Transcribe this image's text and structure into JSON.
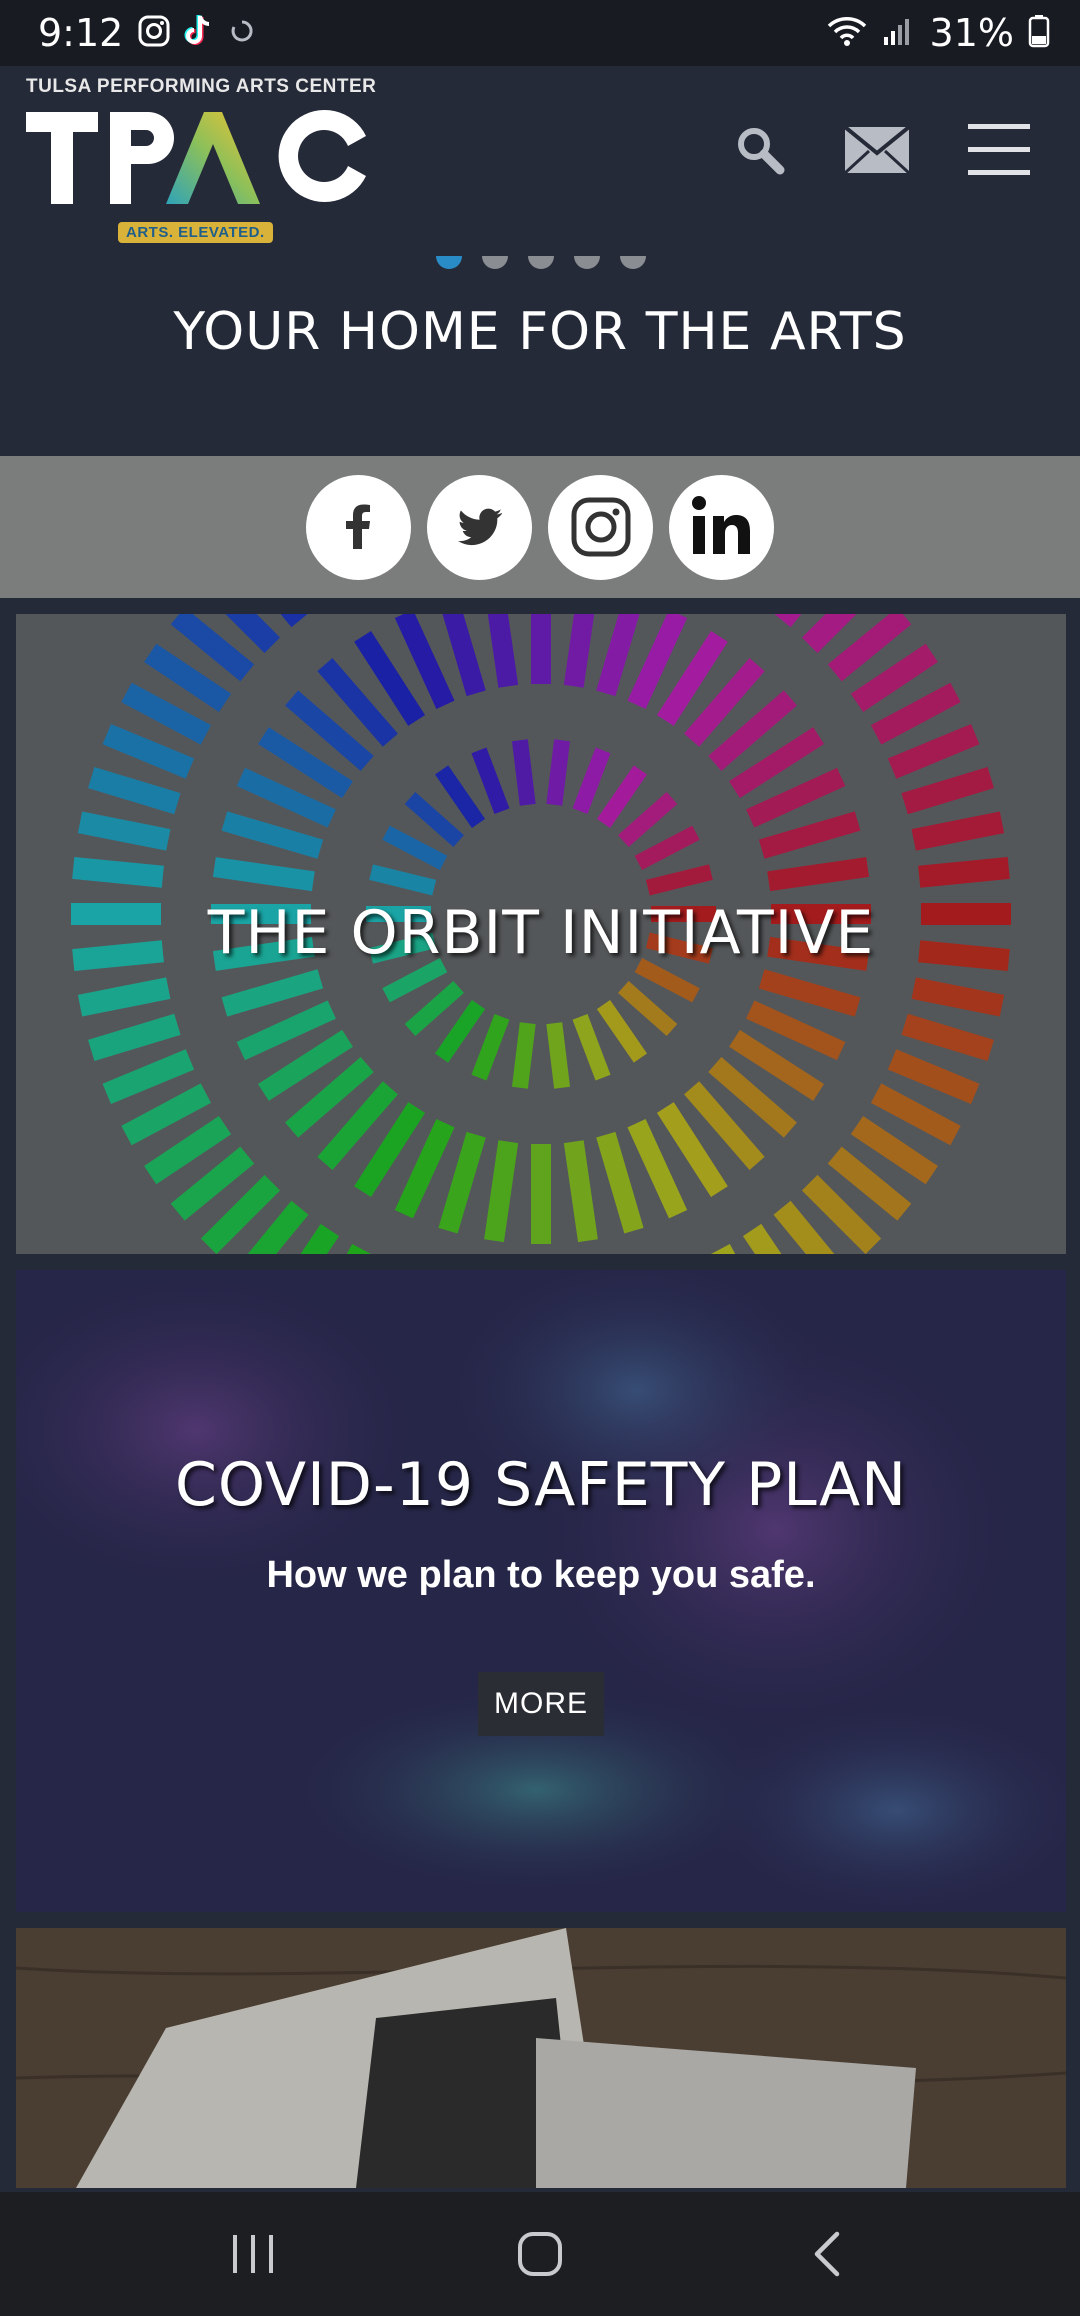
{
  "status_bar": {
    "time": "9:12",
    "battery": "31%",
    "icons_left": [
      "instagram-icon",
      "tiktok-icon",
      "sync-icon"
    ],
    "icons_right": [
      "wifi-icon",
      "signal-icon",
      "battery-icon"
    ]
  },
  "header": {
    "logo_top": "TULSA PERFORMING ARTS CENTER",
    "logo_main": "TPAC",
    "logo_tagline": "ARTS. ELEVATED.",
    "icons": [
      "search-icon",
      "mail-icon",
      "menu-icon"
    ]
  },
  "hero": {
    "title": "YOUR HOME FOR THE ARTS",
    "slide_count": 5,
    "active_slide": 1
  },
  "social": [
    "facebook-icon",
    "twitter-icon",
    "instagram-icon",
    "linkedin-icon"
  ],
  "cards": [
    {
      "title": "THE ORBIT INITIATIVE"
    },
    {
      "title": "COVID-19 SAFETY PLAN",
      "subtitle": "How we plan to keep you safe.",
      "button": "MORE"
    },
    {
      "title": ""
    }
  ],
  "nav": [
    "recent-apps-icon",
    "home-icon",
    "back-icon"
  ],
  "colors": {
    "accent": "#2a8cc6",
    "header_bg": "#252a38",
    "social_bar": "#7b7d7d"
  }
}
